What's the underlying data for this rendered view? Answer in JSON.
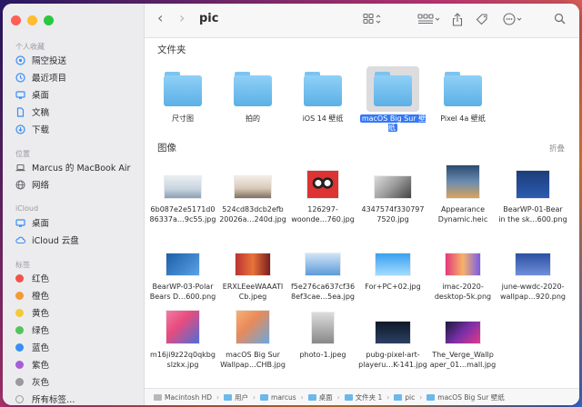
{
  "sidebar": {
    "favorites_heading": "个人收藏",
    "favorites": [
      "隔空投送",
      "最近项目",
      "桌面",
      "文稿",
      "下载"
    ],
    "locations_heading": "位置",
    "locations": [
      "Marcus 的 MacBook Air",
      "网络"
    ],
    "icloud_heading": "iCloud",
    "icloud": [
      "桌面",
      "iCloud 云盘"
    ],
    "tags_heading": "标签",
    "tags": [
      {
        "label": "红色",
        "color": "#f0534a"
      },
      {
        "label": "橙色",
        "color": "#f49a33"
      },
      {
        "label": "黄色",
        "color": "#f5c935"
      },
      {
        "label": "绿色",
        "color": "#52c55a"
      },
      {
        "label": "蓝色",
        "color": "#3a8ef5"
      },
      {
        "label": "紫色",
        "color": "#a55ed6"
      },
      {
        "label": "灰色",
        "color": "#9a9a9e"
      },
      {
        "label": "所有标签…",
        "color": ""
      }
    ]
  },
  "toolbar": {
    "title": "pic",
    "back": "‹",
    "forward": "›"
  },
  "folders_section": {
    "title": "文件夹",
    "items": [
      "尺寸图",
      "拍的",
      "iOS 14 壁纸",
      "macOS Big Sur 壁纸",
      "Pixel 4a 壁纸"
    ]
  },
  "images_section": {
    "title": "图像",
    "collapse": "折叠",
    "items": [
      [
        "6b087e2e5171d0",
        "86337a…9c55.jpg"
      ],
      [
        "524cd83dcb2efb",
        "20026a…240d.jpg"
      ],
      [
        "126297-",
        "woonde…760.jpg"
      ],
      [
        "4347574f330797",
        "7520.jpg"
      ],
      [
        "Appearance",
        "Dynamic.heic"
      ],
      [
        "BearWP-01-Bear",
        "in the sk…600.png"
      ],
      [
        "BearWP-03-Polar",
        "Bears D…600.png"
      ],
      [
        "ERXLEeeWAAATI",
        "Cb.jpeg"
      ],
      [
        "f5e276ca637cf36",
        "8ef3cae…5ea.jpg"
      ],
      [
        "For+PC+02.jpg",
        ""
      ],
      [
        "imac-2020-",
        "desktop-5k.png"
      ],
      [
        "june-wwdc-2020-",
        "wallpap…920.png"
      ],
      [
        "m16ji9z22q0qkbg",
        "slzkx.jpg"
      ],
      [
        "macOS Big Sur",
        "Wallpap…CHB.jpg"
      ],
      [
        "photo-1.jpeg",
        ""
      ],
      [
        "pubg-pixel-art-",
        "playeru…K-141.jpg"
      ],
      [
        "The_Verge_Wallp",
        "aper_01…mall.jpg"
      ]
    ]
  },
  "pathbar": [
    "Macintosh HD",
    "用户",
    "marcus",
    "桌面",
    "文件夹 1",
    "pic",
    "macOS Big Sur 壁纸"
  ]
}
